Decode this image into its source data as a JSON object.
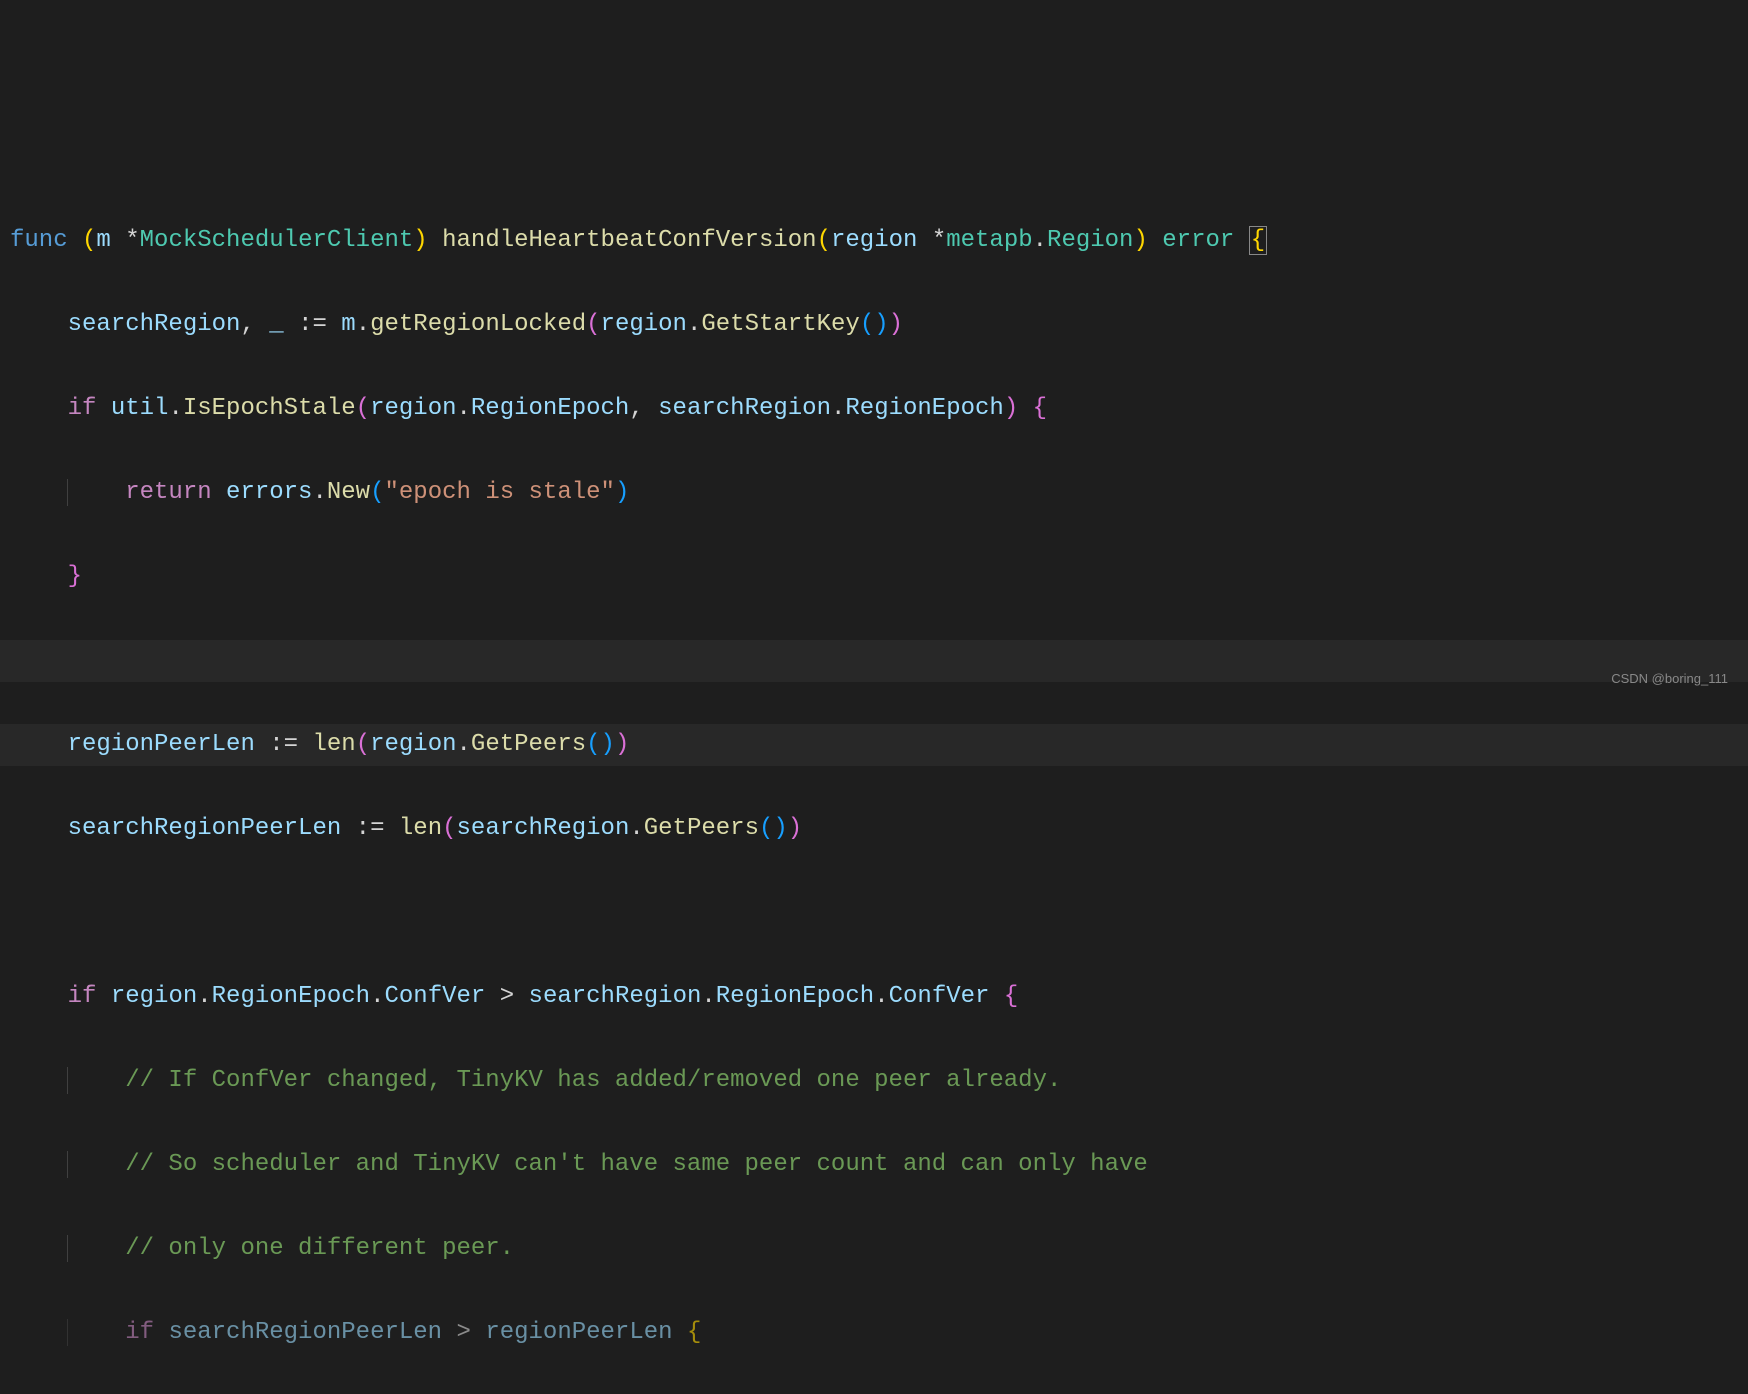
{
  "code": {
    "l1": {
      "func_kw": "func",
      "receiver_open": "(",
      "receiver_var": "m",
      "receiver_star": "*",
      "receiver_type": "MockSchedulerClient",
      "receiver_close": ")",
      "func_name": "handleHeartbeatConfVersion",
      "params_open": "(",
      "param_name": "region",
      "param_star": "*",
      "param_pkg": "metapb",
      "param_dot": ".",
      "param_type": "Region",
      "params_close": ")",
      "return_type": "error",
      "brace": "{"
    },
    "l2": {
      "var1": "searchRegion",
      "comma": ",",
      "blank": "_",
      "walrus": ":=",
      "obj": "m",
      "dot": ".",
      "method": "getRegionLocked",
      "p1": "(",
      "arg": "region",
      "adot": ".",
      "amethod": "GetStartKey",
      "p2": "(",
      "p3": ")",
      "p4": ")"
    },
    "l3": {
      "if": "if",
      "pkg": "util",
      "dot": ".",
      "method": "IsEpochStale",
      "p1": "(",
      "a1": "region",
      "a1dot": ".",
      "a1prop": "RegionEpoch",
      "comma": ",",
      "a2": "searchRegion",
      "a2dot": ".",
      "a2prop": "RegionEpoch",
      "p2": ")",
      "brace": "{"
    },
    "l4": {
      "return": "return",
      "pkg": "errors",
      "dot": ".",
      "method": "New",
      "p1": "(",
      "str": "\"epoch is stale\"",
      "p2": ")"
    },
    "l5": {
      "brace": "}"
    },
    "l7": {
      "var": "regionPeerLen",
      "walrus": ":=",
      "func": "len",
      "p1": "(",
      "arg": "region",
      "dot": ".",
      "method": "GetPeers",
      "p2": "(",
      "p3": ")",
      "p4": ")"
    },
    "l8": {
      "var": "searchRegionPeerLen",
      "walrus": ":=",
      "func": "len",
      "p1": "(",
      "arg": "searchRegion",
      "dot": ".",
      "method": "GetPeers",
      "p2": "(",
      "p3": ")",
      "p4": ")"
    },
    "l10": {
      "if": "if",
      "a1": "region",
      "a1d": ".",
      "a1p": "RegionEpoch",
      "a1d2": ".",
      "a1p2": "ConfVer",
      "op": ">",
      "a2": "searchRegion",
      "a2d": ".",
      "a2p": "RegionEpoch",
      "a2d2": ".",
      "a2p2": "ConfVer",
      "brace": "{"
    },
    "l11": {
      "comment": "// If ConfVer changed, TinyKV has added/removed one peer already."
    },
    "l12": {
      "comment": "// So scheduler and TinyKV can't have same peer count and can only have"
    },
    "l13": {
      "comment": "// only one different peer."
    },
    "l14": {
      "if": "if",
      "a1": "searchRegionPeerLen",
      "op": ">",
      "a2": "regionPeerLen",
      "brace": "{"
    }
  },
  "watermark": "CSDN @boring_111"
}
